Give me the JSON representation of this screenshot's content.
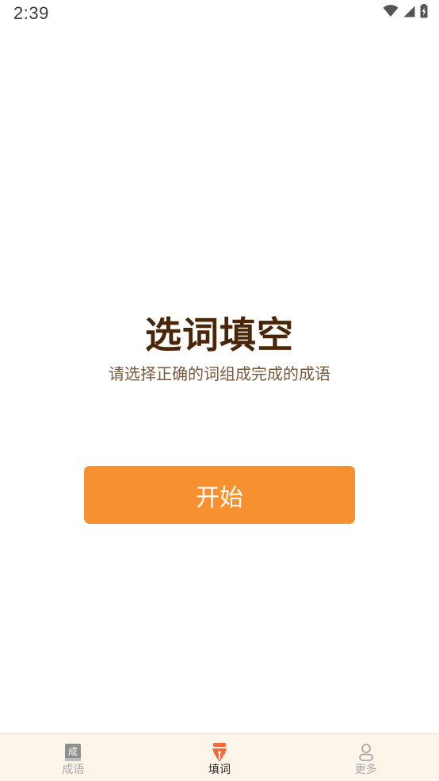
{
  "status_bar": {
    "time": "2:39",
    "icons": [
      "wifi-icon",
      "cell-signal-icon",
      "battery-charging-icon"
    ]
  },
  "main": {
    "title": "选词填空",
    "subtitle": "请选择正确的词组成完成的成语",
    "start_button": "开始"
  },
  "bottom_nav": {
    "items": [
      {
        "label": "成语",
        "icon": "book-icon",
        "icon_glyph": "成",
        "active": false
      },
      {
        "label": "填词",
        "icon": "pen-nib-icon",
        "active": true
      },
      {
        "label": "更多",
        "icon": "user-icon",
        "active": false
      }
    ]
  },
  "colors": {
    "accent": "#f79130",
    "title": "#4a2608",
    "subtitle": "#7a5a3e",
    "nav_background": "#fdf4ea",
    "nav_inactive": "#a8a8a8",
    "nav_active": "#222222"
  }
}
